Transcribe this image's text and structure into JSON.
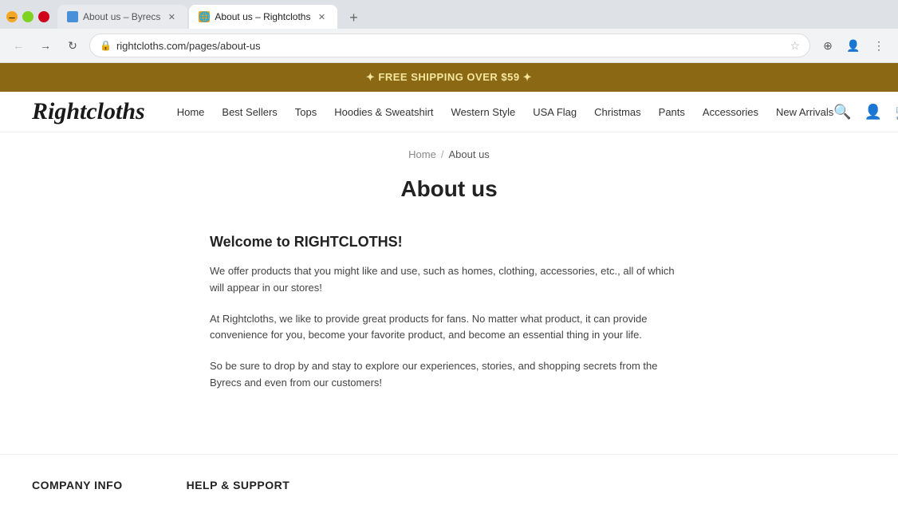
{
  "browser": {
    "tabs": [
      {
        "id": "tab1",
        "label": "About us – Byrecs",
        "favicon": "blue",
        "active": false
      },
      {
        "id": "tab2",
        "label": "About us – Rightcloths",
        "favicon": "orange",
        "active": true
      }
    ],
    "url": "rightcloths.com/pages/about-us",
    "new_tab_title": "+",
    "window_controls": {
      "minimize": "–",
      "maximize": "□",
      "close": "✕"
    }
  },
  "shipping_banner": {
    "text": "✦ FREE SHIPPING OVER $59 ✦"
  },
  "header": {
    "logo": "Rightcloths",
    "logo_tagline": "",
    "nav_items": [
      {
        "label": "Home",
        "href": "#"
      },
      {
        "label": "Best Sellers",
        "href": "#"
      },
      {
        "label": "Tops",
        "href": "#"
      },
      {
        "label": "Hoodies & Sweatshirt",
        "href": "#"
      },
      {
        "label": "Western Style",
        "href": "#"
      },
      {
        "label": "USA Flag",
        "href": "#"
      },
      {
        "label": "Christmas",
        "href": "#"
      },
      {
        "label": "Pants",
        "href": "#"
      },
      {
        "label": "Accessories",
        "href": "#"
      },
      {
        "label": "New Arrivals",
        "href": "#"
      }
    ]
  },
  "breadcrumb": {
    "items": [
      {
        "label": "Home",
        "href": "#"
      },
      {
        "separator": "/",
        "label": "About us"
      }
    ]
  },
  "page": {
    "title": "About us",
    "sections": [
      {
        "heading": "Welcome to RIGHTCLOTHS!",
        "paragraphs": [
          "We offer products that you might like and use, such as homes, clothing, accessories, etc., all of which will appear in our stores!",
          "At Rightcloths, we like to provide great products for fans. No matter what product, it can provide convenience for you, become your favorite product, and become an essential thing in your life.",
          "So be sure to drop by and stay to explore our experiences, stories, and shopping secrets from the Byrecs and even from our customers!"
        ]
      }
    ]
  },
  "footer": {
    "columns": [
      {
        "id": "company-info",
        "heading": "COMPANY INFO"
      },
      {
        "id": "help-support",
        "heading": "HELP & SUPPORT"
      }
    ]
  }
}
